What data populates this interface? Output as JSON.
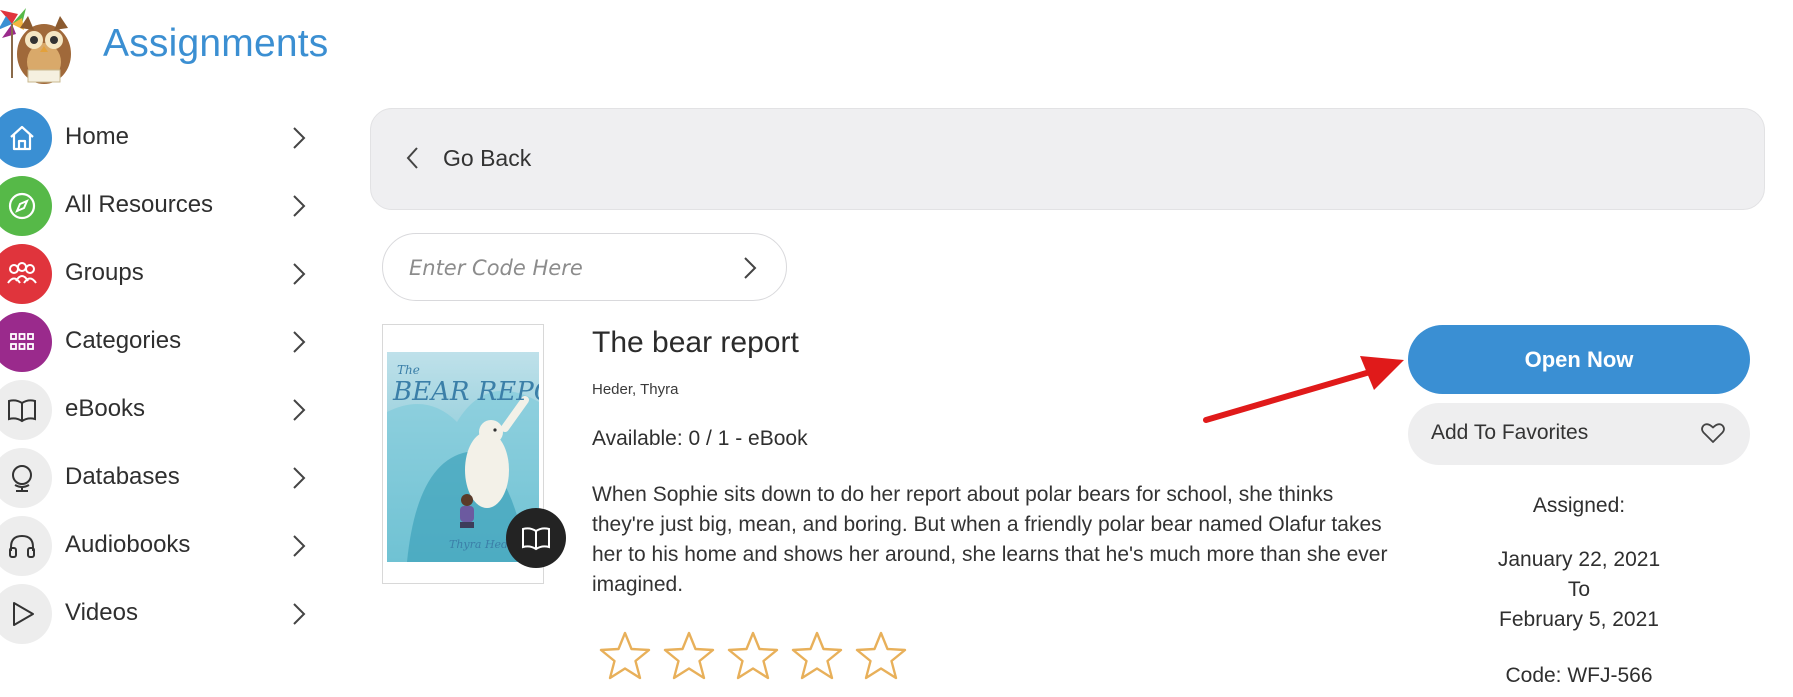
{
  "header": {
    "title": "Assignments",
    "logo_icon": "owl-logo-icon"
  },
  "sidebar": {
    "items": [
      {
        "label": "Home",
        "icon": "home-icon",
        "color": "#3a8fd3"
      },
      {
        "label": "All Resources",
        "icon": "compass-icon",
        "color": "#56b948"
      },
      {
        "label": "Groups",
        "icon": "group-icon",
        "color": "#e0343c"
      },
      {
        "label": "Categories",
        "icon": "grid-icon",
        "color": "#9a2a8c"
      },
      {
        "label": "eBooks",
        "icon": "book-icon",
        "color": "#ededed"
      },
      {
        "label": "Databases",
        "icon": "globe-icon",
        "color": "#ededed"
      },
      {
        "label": "Audiobooks",
        "icon": "headphones-icon",
        "color": "#ededed"
      },
      {
        "label": "Videos",
        "icon": "play-icon",
        "color": "#ededed"
      }
    ]
  },
  "main": {
    "go_back_label": "Go Back",
    "code_input": {
      "placeholder": "Enter Code Here",
      "value": ""
    },
    "book": {
      "cover_title": "The Bear Report",
      "cover_author": "Thyra Heder",
      "title": "The bear report",
      "author": "Heder, Thyra",
      "availability": "Available: 0 / 1 - eBook",
      "description": "When Sophie sits down to do her report about polar bears for school, she thinks they're just big, mean, and boring. But when a friendly polar bear named Olafur takes her to his home and shows her around, she learns that he's much more than she ever imagined.",
      "rating": 0,
      "rating_max": 5,
      "format_icon": "open-book-icon"
    },
    "actions": {
      "open_now_label": "Open Now",
      "add_favorites_label": "Add To Favorites"
    },
    "assignment": {
      "label": "Assigned:",
      "start": "January 22, 2021",
      "to": "To",
      "end": "February 5, 2021",
      "code": "Code: WFJ-566"
    }
  },
  "colors": {
    "accent": "#3a8fd3",
    "star": "#e8b05a",
    "annotation_arrow": "#e01a1a"
  }
}
